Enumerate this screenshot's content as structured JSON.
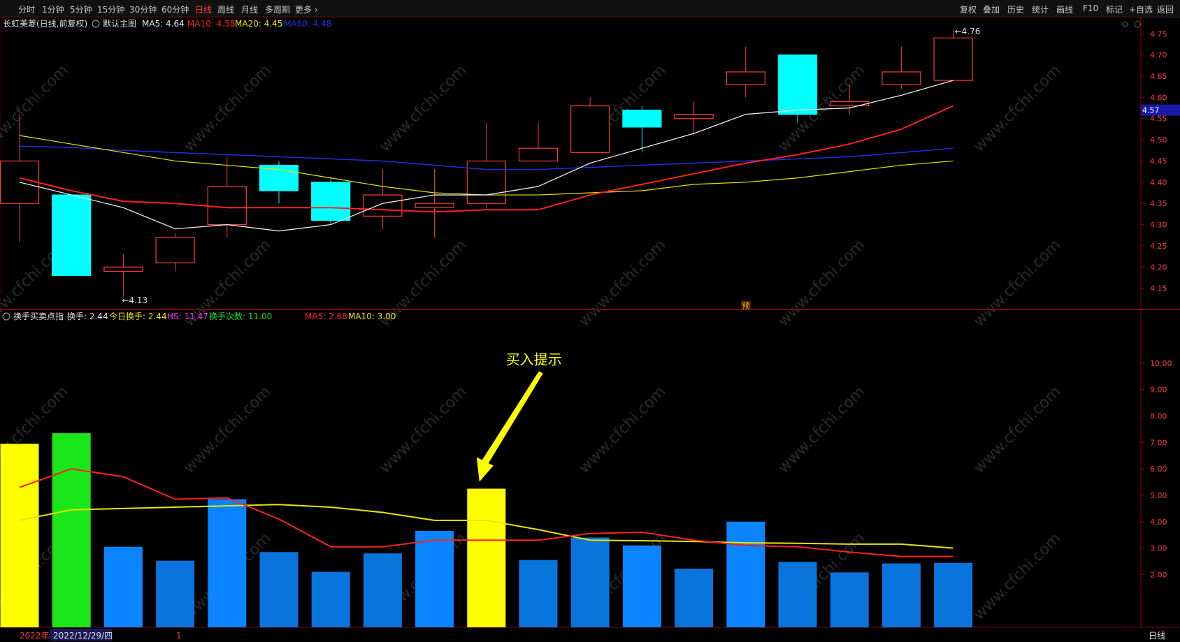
{
  "toolbar": {
    "periods": [
      "分时",
      "1分钟",
      "5分钟",
      "15分钟",
      "30分钟",
      "60分钟",
      "日线",
      "周线",
      "月线",
      "多周期",
      "更多 ›"
    ],
    "active_period": "日线",
    "right_buttons": [
      "复权",
      "叠加",
      "历史",
      "统计",
      "画线",
      "F10",
      "标记",
      "+自选",
      "返回"
    ]
  },
  "colors": {
    "up": "#ff3b3b",
    "down": "#00ffff",
    "ma5": "#e8e8e8",
    "ma10": "#ff2020",
    "ma20": "#e6e600",
    "ma60": "#2030e0",
    "vol_blue": "#0a84ff",
    "vol_blue_dark": "#0a74dd",
    "vol_yellow": "#ffff00",
    "vol_green": "#19e619",
    "cur_price_bg": "#1a1aa8"
  },
  "main": {
    "title": "长虹美菱(日线,前复权)",
    "subtitle": "默认主图",
    "ma_labels": [
      {
        "text": "MA5: 4.64",
        "color": "#e8e8e8"
      },
      {
        "text": "MA10: 4.58",
        "color": "#ff2020"
      },
      {
        "text": "MA20: 4.45",
        "color": "#e6e600"
      },
      {
        "text": "MA60: 4.48",
        "color": "#2030e0"
      }
    ],
    "high_label": "4.76",
    "low_label": "4.13",
    "current_price": "4.57",
    "yu_marker": "预",
    "y_ticks": [
      "4.75",
      "4.70",
      "4.65",
      "4.60",
      "4.55",
      "4.50",
      "4.45",
      "4.40",
      "4.35",
      "4.30",
      "4.25",
      "4.20",
      "4.15"
    ]
  },
  "chart_data": [
    {
      "type": "candlestick",
      "y_range": [
        4.1,
        4.79
      ],
      "candles": [
        {
          "o": 4.35,
          "h": 4.56,
          "l": 4.26,
          "c": 4.45
        },
        {
          "o": 4.37,
          "h": 4.37,
          "l": 4.18,
          "c": 4.18
        },
        {
          "o": 4.19,
          "h": 4.23,
          "l": 4.13,
          "c": 4.2
        },
        {
          "o": 4.21,
          "h": 4.28,
          "l": 4.19,
          "c": 4.27
        },
        {
          "o": 4.3,
          "h": 4.46,
          "l": 4.27,
          "c": 4.39
        },
        {
          "o": 4.44,
          "h": 4.45,
          "l": 4.35,
          "c": 4.38
        },
        {
          "o": 4.4,
          "h": 4.41,
          "l": 4.3,
          "c": 4.31
        },
        {
          "o": 4.32,
          "h": 4.43,
          "l": 4.29,
          "c": 4.37
        },
        {
          "o": 4.34,
          "h": 4.43,
          "l": 4.27,
          "c": 4.35
        },
        {
          "o": 4.35,
          "h": 4.54,
          "l": 4.34,
          "c": 4.45
        },
        {
          "o": 4.45,
          "h": 4.54,
          "l": 4.45,
          "c": 4.48
        },
        {
          "o": 4.47,
          "h": 4.6,
          "l": 4.47,
          "c": 4.58
        },
        {
          "o": 4.57,
          "h": 4.58,
          "l": 4.47,
          "c": 4.53
        },
        {
          "o": 4.55,
          "h": 4.59,
          "l": 4.51,
          "c": 4.56
        },
        {
          "o": 4.63,
          "h": 4.72,
          "l": 4.6,
          "c": 4.66
        },
        {
          "o": 4.7,
          "h": 4.7,
          "l": 4.54,
          "c": 4.56
        },
        {
          "o": 4.58,
          "h": 4.63,
          "l": 4.56,
          "c": 4.59
        },
        {
          "o": 4.63,
          "h": 4.72,
          "l": 4.62,
          "c": 4.66
        },
        {
          "o": 4.64,
          "h": 4.76,
          "l": 4.64,
          "c": 4.74
        }
      ],
      "ma5": [
        4.4,
        4.37,
        4.34,
        4.29,
        4.3,
        4.285,
        4.3,
        4.35,
        4.37,
        4.37,
        4.39,
        4.445,
        4.48,
        4.515,
        4.56,
        4.57,
        4.575,
        4.605,
        4.64
      ],
      "ma10": [
        4.41,
        4.38,
        4.355,
        4.35,
        4.34,
        4.34,
        4.34,
        4.335,
        4.33,
        4.335,
        4.335,
        4.37,
        4.395,
        4.42,
        4.445,
        4.465,
        4.49,
        4.525,
        4.58
      ],
      "ma20": [
        4.51,
        4.49,
        4.47,
        4.45,
        4.44,
        4.43,
        4.41,
        4.39,
        4.375,
        4.37,
        4.37,
        4.375,
        4.38,
        4.395,
        4.4,
        4.41,
        4.425,
        4.44,
        4.45
      ],
      "ma60": [
        4.485,
        4.482,
        4.475,
        4.47,
        4.465,
        4.46,
        4.455,
        4.45,
        4.44,
        4.43,
        4.43,
        4.435,
        4.44,
        4.445,
        4.45,
        4.455,
        4.46,
        4.47,
        4.48
      ]
    },
    {
      "type": "bar",
      "title": "换手买卖点指",
      "y_range": [
        0,
        11.4
      ],
      "values": [
        6.95,
        7.35,
        3.05,
        2.52,
        4.85,
        2.85,
        2.1,
        2.8,
        3.65,
        5.25,
        2.55,
        3.4,
        3.1,
        2.22,
        4.0,
        2.48,
        2.08,
        2.42,
        2.44
      ],
      "bar_colors": [
        "yellow",
        "green",
        "blue",
        "dark",
        "blue",
        "dark",
        "dark",
        "dark",
        "blue",
        "yellow",
        "dark",
        "dark",
        "blue",
        "dark",
        "blue",
        "dark",
        "dark",
        "dark",
        "dark"
      ],
      "ma5": [
        5.3,
        6.0,
        5.7,
        4.85,
        4.9,
        4.1,
        3.05,
        3.05,
        3.3,
        3.3,
        3.3,
        3.55,
        3.6,
        3.3,
        3.1,
        3.05,
        2.85,
        2.68,
        2.68
      ],
      "ma10": [
        4.05,
        4.45,
        4.5,
        4.55,
        4.6,
        4.65,
        4.55,
        4.35,
        4.05,
        4.05,
        3.7,
        3.3,
        3.28,
        3.25,
        3.2,
        3.18,
        3.15,
        3.15,
        3.0
      ],
      "y_ticks": [
        "10.00",
        "9.00",
        "8.00",
        "7.00",
        "6.00",
        "5.00",
        "4.00",
        "3.00",
        "2.00"
      ]
    }
  ],
  "indicator": {
    "name": "换手买卖点指",
    "labels": [
      {
        "text": "换手: 2.44",
        "color": "#e0e0e0"
      },
      {
        "text": "今日换手: 2.44",
        "color": "#e6e600"
      },
      {
        "text": "HS: 11.47",
        "color": "#ff33ff"
      },
      {
        "text": "换手次数: 11.00",
        "color": "#22dd22"
      },
      {
        "text": "MA5: 2.68",
        "color": "#ff2020"
      },
      {
        "text": "MA10: 3.00",
        "color": "#e6e600"
      }
    ]
  },
  "annotation": {
    "text": "买入提示"
  },
  "footer": {
    "year": "2022年",
    "date": "2022/12/29/四",
    "mark": "1",
    "period": "日线"
  },
  "watermark": "www.cfchi.com"
}
